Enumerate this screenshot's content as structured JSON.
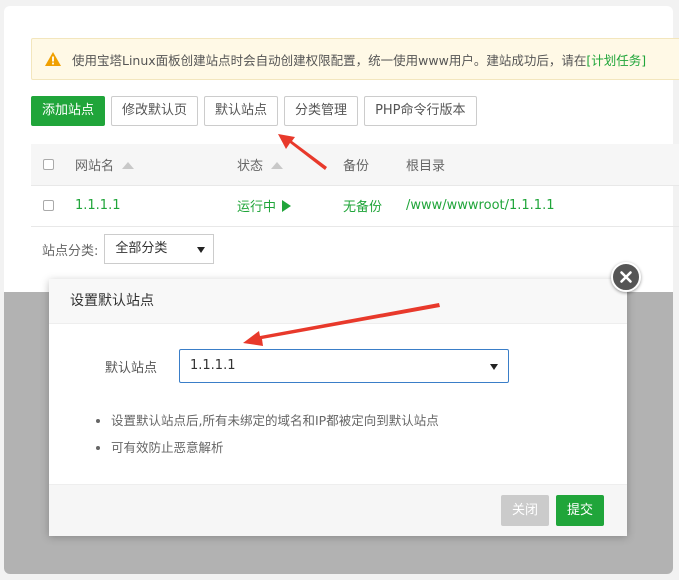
{
  "notice": {
    "text": "使用宝塔Linux面板创建站点时会自动创建权限配置，统一使用www用户。建站成功后，请在",
    "link": "[计划任务]"
  },
  "toolbar": {
    "add_site": "添加站点",
    "modify_default_page": "修改默认页",
    "default_site": "默认站点",
    "category_manage": "分类管理",
    "php_cli_version": "PHP命令行版本"
  },
  "table": {
    "headers": {
      "name": "网站名",
      "status": "状态",
      "backup": "备份",
      "root": "根目录"
    },
    "rows": [
      {
        "name": "1.1.1.1",
        "status": "运行中",
        "backup": "无备份",
        "root": "/www/wwwroot/1.1.1.1"
      }
    ]
  },
  "category": {
    "label": "站点分类:",
    "selected": "全部分类"
  },
  "dialog": {
    "title": "设置默认站点",
    "field_label": "默认站点",
    "field_value": "1.1.1.1",
    "tips": [
      "设置默认站点后,所有未绑定的域名和IP都被定向到默认站点",
      "可有效防止恶意解析"
    ],
    "close_label": "关闭",
    "submit_label": "提交"
  },
  "colors": {
    "accent": "#20a53a",
    "annotation_arrow": "#e8392b",
    "select_border": "#3a7ec8"
  }
}
